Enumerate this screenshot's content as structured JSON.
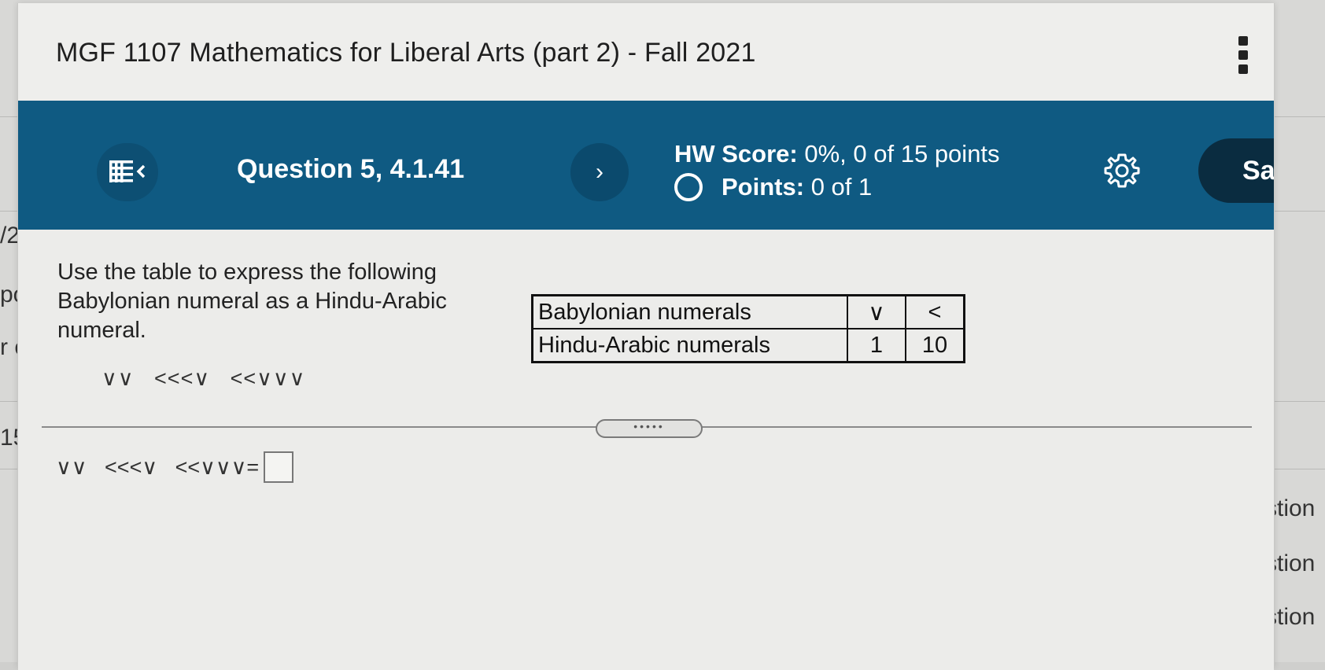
{
  "background": {
    "fragments": [
      "/2",
      "po",
      "r c",
      "15",
      "stion",
      "stion",
      "stion"
    ]
  },
  "header": {
    "course_title": "MGF 1107 Mathematics for Liberal Arts (part 2) - Fall 2021"
  },
  "question_bar": {
    "question_title": "Question 5, 4.1.41",
    "hw_score_label": "HW Score:",
    "hw_score_value": "0%, 0 of 15 points",
    "points_label": "Points:",
    "points_value": "0 of 1",
    "save_label": "Sa",
    "next_glyph": "›",
    "colors": {
      "bar": "#0f5a82",
      "save": "#0a2c40"
    }
  },
  "question": {
    "prompt": "Use the table to express the following Babylonian numeral as a Hindu-Arabic numeral.",
    "numeral_display": "∨∨   <<<∨   <<∨∨∨",
    "table": {
      "rows": [
        {
          "label": "Babylonian numerals",
          "c1": "∨",
          "c2": "<"
        },
        {
          "label": "Hindu-Arabic numerals",
          "c1": "1",
          "c2": "10"
        }
      ]
    },
    "answer_lhs": "∨∨   <<<∨   <<∨∨∨=",
    "answer_value": ""
  },
  "icons": {
    "menu": "menu-collapse-icon",
    "next": "chevron-right-icon",
    "status": "circle-outline-icon",
    "settings": "gear-icon",
    "more": "kebab-menu-icon"
  }
}
